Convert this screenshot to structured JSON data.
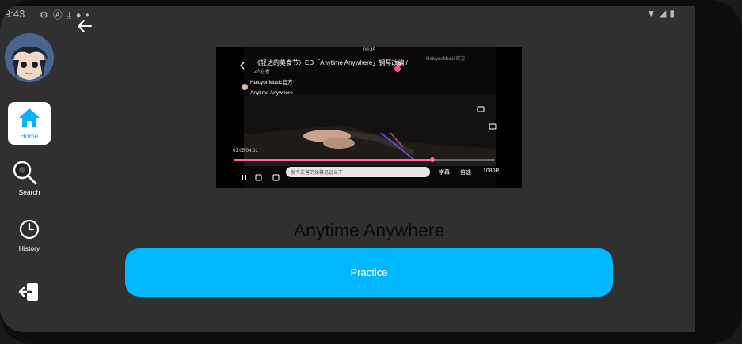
{
  "status_bar": {
    "time": "9:43",
    "left_icons": [
      "gear-icon",
      "a-badge-icon",
      "download-icon",
      "mic-icon",
      "dot-icon"
    ],
    "right_icons": [
      "wifi-icon",
      "signal-icon",
      "battery-icon"
    ]
  },
  "sidebar": {
    "items": [
      {
        "label": "Home",
        "icon": "home-icon",
        "active": true
      },
      {
        "label": "Search",
        "icon": "search-icon",
        "active": false
      },
      {
        "label": "History",
        "icon": "clock-icon",
        "active": false
      }
    ],
    "logout_icon": "logout-icon"
  },
  "video": {
    "title": "《轻达的美食节〉ED「Anytime Anywhere」钢琴改编 /",
    "phone_time": "09:45",
    "subtitle": "2人在看",
    "channel": "HalcyonMusic官方",
    "song": "Anytime Anywhere",
    "watermark": "HalcyonMusic官方",
    "position": "03:05/04:01",
    "danmaku_placeholder": "发个友善的弹幕见证当下",
    "controls": {
      "subtitle_btn": "字幕",
      "speed_btn": "倍速",
      "quality_btn": "1080P"
    },
    "progress": 0.76
  },
  "main": {
    "song_title": "Anytime Anywhere",
    "practice_label": "Practice"
  },
  "colors": {
    "accent": "#00b8ff",
    "background": "#303030"
  }
}
